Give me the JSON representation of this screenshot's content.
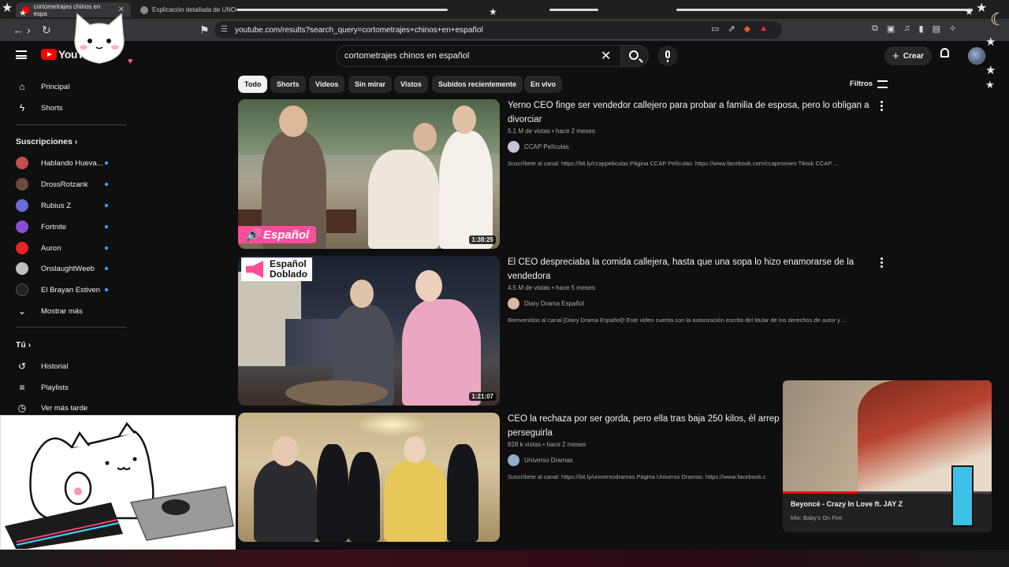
{
  "browser": {
    "tabs": [
      {
        "title": "cortometrajes chinos en espa",
        "active": true
      },
      {
        "title": "Explicación detallada de UNO",
        "active": false
      }
    ],
    "url": "youtube.com/results?search_query=cortometrajes+chinos+en+español"
  },
  "header": {
    "logo_text": "YouTube",
    "search_value": "cortometrajes chinos en español",
    "create_label": "Crear"
  },
  "sidebar": {
    "main": [
      {
        "label": "Principal",
        "icon": "home-icon"
      },
      {
        "label": "Shorts",
        "icon": "shorts-icon"
      }
    ],
    "subscriptions_title": "Suscripciones",
    "subscriptions": [
      {
        "label": "Hablando Hueva...",
        "color": "#c44d4d"
      },
      {
        "label": "DrossRotzank",
        "color": "#6b4c3b"
      },
      {
        "label": "Rubius Z",
        "color": "#6a6adb"
      },
      {
        "label": "Fortnite",
        "color": "#8a4dd9"
      },
      {
        "label": "Auron",
        "color": "#e52525"
      },
      {
        "label": "OnslaughtWeeb",
        "color": "#bfbfbf"
      },
      {
        "label": "El Brayan Estiven",
        "color": "#222222"
      }
    ],
    "show_more": "Mostrar más",
    "you_title": "Tú",
    "you_items": [
      {
        "label": "Historial",
        "icon": "history-icon"
      },
      {
        "label": "Playlists",
        "icon": "playlists-icon"
      },
      {
        "label": "Ver más tarde",
        "icon": "clock-icon"
      }
    ]
  },
  "chips": [
    "Todo",
    "Shorts",
    "Videos",
    "Sin mirar",
    "Vistos",
    "Subidos recientemente",
    "En vivo"
  ],
  "filters_label": "Filtros",
  "results": [
    {
      "title": "Yerno CEO finge ser vendedor callejero para probar a familia de esposa, pero lo obligan a divorciar",
      "stats": "5.1 M de vistas • hace 2 meses",
      "channel": "CCAP Películas",
      "description": "Suscríbete al canal: https://bit.ly/ccappeliculas Página CCAP Películas: https://www.facebook.com/ccapmovies Tiktok CCAP ...",
      "duration": "1:38:25",
      "badge": "Español"
    },
    {
      "title": "El CEO despreciaba la comida callejera, hasta que una sopa lo hizo enamorarse de la vendedora",
      "stats": "4.5 M de vistas • hace 5 meses",
      "channel": "Diary Drama Español",
      "description": "Bienvenidos al canal [Diary Drama Español]! Este video cuenta con la autorización escrita del titular de los derechos de autor y ...",
      "duration": "1:21:07",
      "badge_line1": "Español",
      "badge_line2": "Doblado"
    },
    {
      "title": "CEO la rechaza por ser gorda, pero ella tras baja 250 kilos, él arrep perseguirla",
      "stats": "828 k vistas • hace 2 meses",
      "channel": "Universo Dramas",
      "description": "Suscríbete al canal: https://bit.ly/universodramas Página Universo Dramas: https://www.facebook.c"
    }
  ],
  "miniplayer": {
    "title": "Beyoncé - Crazy In Love ft. JAY Z",
    "subtitle": "Mix: Baby's On Fire",
    "progress": 0.36
  },
  "colors": {
    "background": "#0f0f0f",
    "accent": "#ff0000",
    "badge_pink": "#ff4d9a"
  }
}
